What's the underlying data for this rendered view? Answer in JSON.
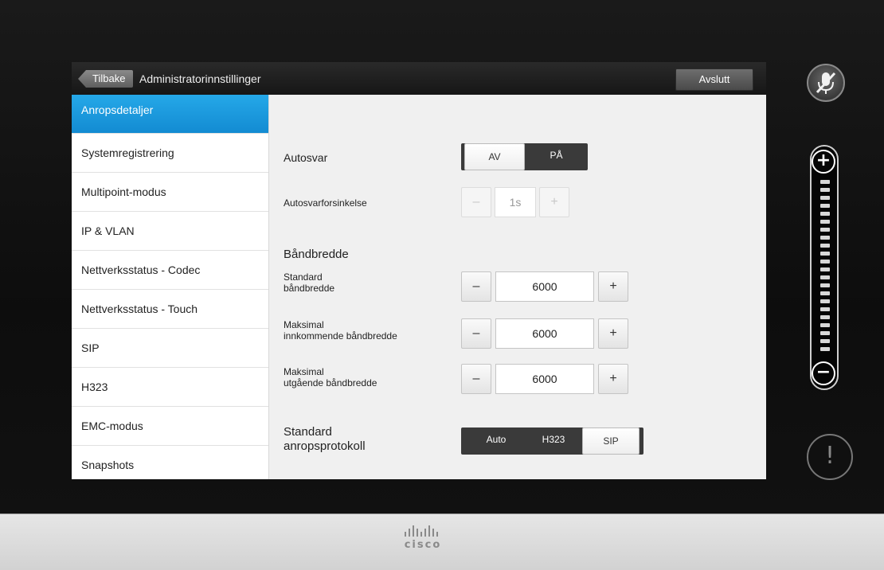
{
  "header": {
    "back_label": "Tilbake",
    "title": "Administratorinnstillinger",
    "exit_label": "Avslutt"
  },
  "sidebar": {
    "items": [
      {
        "label": "Anropsdetaljer",
        "active": true
      },
      {
        "label": "Systemregistrering"
      },
      {
        "label": "Multipoint-modus"
      },
      {
        "label": "IP & VLAN"
      },
      {
        "label": "Nettverksstatus - Codec"
      },
      {
        "label": "Nettverksstatus - Touch"
      },
      {
        "label": "SIP"
      },
      {
        "label": "H323"
      },
      {
        "label": "EMC-modus"
      },
      {
        "label": "Snapshots"
      }
    ]
  },
  "settings": {
    "autosvar": {
      "label": "Autosvar",
      "off_label": "AV",
      "on_label": "PÅ",
      "selected": "AV"
    },
    "autosvar_delay": {
      "label": "Autosvarforsinkelse",
      "value": "1s",
      "minus": "–",
      "plus": "+",
      "enabled": false
    },
    "bandwidth_heading": "Båndbredde",
    "standard_bw": {
      "label_line1": "Standard",
      "label_line2": "båndbredde",
      "value": "6000",
      "minus": "–",
      "plus": "+"
    },
    "max_in_bw": {
      "label_line1": "Maksimal",
      "label_line2": "innkommende båndbredde",
      "value": "6000",
      "minus": "–",
      "plus": "+"
    },
    "max_out_bw": {
      "label_line1": "Maksimal",
      "label_line2": "utgående båndbredde",
      "value": "6000",
      "minus": "–",
      "plus": "+"
    },
    "protocol": {
      "label_line1": "Standard",
      "label_line2": "anropsprotokoll",
      "options": [
        "Auto",
        "H323",
        "SIP"
      ],
      "selected": "SIP"
    }
  },
  "controls": {
    "alert_symbol": "!",
    "vol_plus": "+",
    "vol_minus": "−"
  },
  "footer": {
    "brand": "cisco"
  },
  "colors": {
    "accent": "#1a9ee0",
    "titlebar": "#1e1e1e",
    "toggle_dark": "#3a3a3a"
  }
}
